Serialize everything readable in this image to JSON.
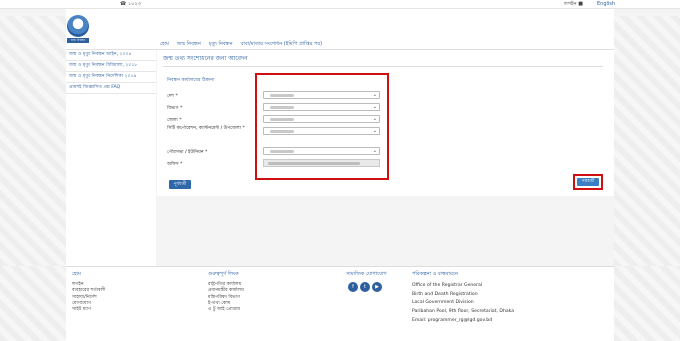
{
  "topbar": {
    "hotline": "১০২৩",
    "login": "লগইন",
    "language": "English"
  },
  "header": {
    "logo_text": "জন্ম নিবন্ধন",
    "nav": [
      "হোম",
      "জন্ম নিবন্ধন",
      "মৃত্যু নিবন্ধন",
      "বাবা/মাতার সংশোধন (ইমিপি প্রাপ্তির পর)"
    ]
  },
  "sidebar": {
    "items": [
      "জন্ম ও মৃত্যু নিবন্ধন আইন, ২০০৪",
      "জন্ম ও মৃত্যু নিবন্ধন বিধিমালা, ২০১৮",
      "জন্ম ও মৃত্যু নিবন্ধন নির্দেশিকা ২০১৯",
      "প্রায়শই জিজ্ঞাসিত প্রশ্ন FAQ"
    ]
  },
  "main": {
    "title": "জন্ম তথ্য সংশোধনের জন্য আবেদন",
    "section_title": "নিবন্ধন কার্যালয়ের ঠিকানা",
    "fields": [
      {
        "label": "দেশ *"
      },
      {
        "label": "বিভাগ *"
      },
      {
        "label": "জেলা *"
      },
      {
        "label": "সিটি কর্পোরেশন, ক্যান্টনমেন্ট / উপজেলা *"
      },
      {
        "label": "পৌরসভা / ইউনিয়ন *"
      },
      {
        "label": "অফিস *"
      }
    ],
    "prev_button": "পূর্ববর্তী",
    "next_button": "পরবর্তী"
  },
  "footer": {
    "col1": {
      "title": "হোম",
      "links": [
        "লগইন",
        "ব্যবহারের শর্তাবলী",
        "সাহায্য/নির্দেশ",
        "যোগাযোগ",
        "সাইট ম্যাপ"
      ]
    },
    "col2": {
      "title": "গুরুত্বপূর্ণ লিংক",
      "links": [
        "রাষ্ট্রপতির কার্যালয়",
        "প্রধানমন্ত্রীর কার্যালয়",
        "মন্ত্রিপরিষদ বিভাগ",
        "ই-তথ্য কোষ",
        "এ টু আই প্রোগ্রাম"
      ]
    },
    "col3": {
      "title": "সামাজিক যোগাযোগ"
    },
    "col4": {
      "title": "পরিকল্পনা ও বাস্তবায়নে",
      "lines": [
        "Office of the Registrar General",
        "Birth and Death Registration",
        "Local Government Division",
        "Paribahan Pool, 9th floor, Secretariat, Dhaka",
        "Email: programmer_rg@lgd.gov.bd"
      ]
    }
  }
}
